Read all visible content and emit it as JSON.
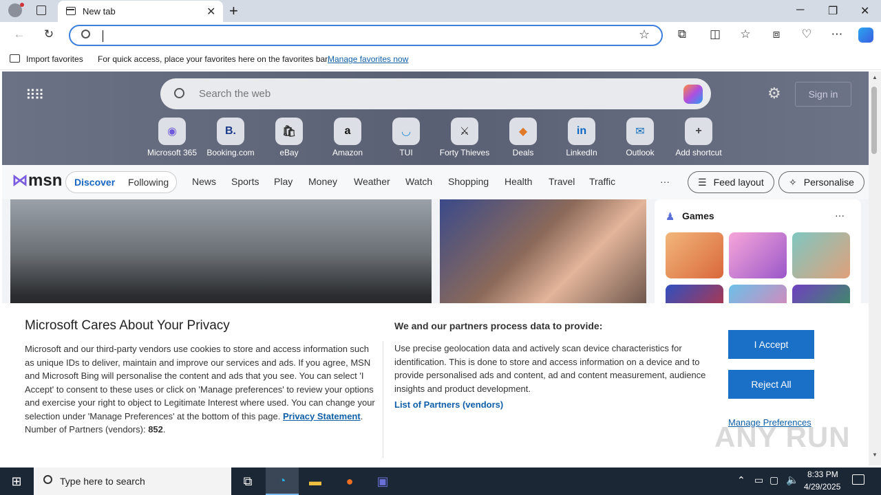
{
  "browser": {
    "tab_title": "New tab",
    "tab_close": "✕",
    "new_tab": "+",
    "minimize": "─",
    "restore": "❐",
    "close": "✕",
    "address_value": "",
    "back": "←",
    "refresh": "↻"
  },
  "favbar": {
    "import_label": "Import favorites",
    "hint": "For quick access, place your favorites here on the favorites bar.",
    "manage_link": "Manage favorites now"
  },
  "newtab": {
    "search_placeholder": "Search the web",
    "sign_in": "Sign in",
    "shortcuts": [
      {
        "label": "Microsoft 365",
        "glyph": "◉",
        "color": "#6e59d9"
      },
      {
        "label": "Booking.com",
        "glyph": "B.",
        "color": "#1a3a8a"
      },
      {
        "label": "eBay",
        "glyph": "🛍",
        "color": "#333"
      },
      {
        "label": "Amazon",
        "glyph": "a",
        "color": "#111"
      },
      {
        "label": "TUI",
        "glyph": "◡",
        "color": "#1a8ad8"
      },
      {
        "label": "Forty Thieves",
        "glyph": "⚔",
        "color": "#222"
      },
      {
        "label": "Deals",
        "glyph": "◆",
        "color": "#e07a2a"
      },
      {
        "label": "LinkedIn",
        "glyph": "in",
        "color": "#0a66c2"
      },
      {
        "label": "Outlook",
        "glyph": "✉",
        "color": "#0f6cbd"
      },
      {
        "label": "Add shortcut",
        "glyph": "+",
        "color": "#444"
      }
    ]
  },
  "msn": {
    "logo": "msn",
    "tabs": [
      "Discover",
      "Following"
    ],
    "nav": [
      "News",
      "Sports",
      "Play",
      "Money",
      "Weather",
      "Watch",
      "Shopping",
      "Health",
      "Travel",
      "Traffic"
    ],
    "more": "···",
    "feed_layout": "Feed layout",
    "personalise": "Personalise",
    "games_title": "Games",
    "games_more": "···"
  },
  "privacy": {
    "title": "Microsoft Cares About Your Privacy",
    "body": "Microsoft and our third-party vendors use cookies to store and access information such as unique IDs to deliver, maintain and improve our services and ads. If you agree, MSN and Microsoft Bing will personalise the content and ads that you see. You can select 'I Accept' to consent to these uses or click on 'Manage preferences' to review your options and exercise your right to object to Legitimate Interest where used.  You can change your selection under 'Manage Preferences' at the bottom of this page.",
    "privacy_link": "Privacy Statement",
    "partners_label": "Number of Partners (vendors):",
    "partners_count": "852",
    "process_title": "We and our partners process data to provide:",
    "process_body": "Use precise geolocation data and actively scan device characteristics for identification. This is done to store and access information on a device and to provide personalised ads and content, ad and content measurement, audience insights and product development.",
    "partners_link": "List of Partners (vendors)",
    "accept": "I Accept",
    "reject": "Reject All",
    "manage": "Manage Preferences"
  },
  "taskbar": {
    "search_placeholder": "Type here to search",
    "time": "8:33 PM",
    "date": "4/29/2025"
  },
  "watermark": "ANY RUN"
}
